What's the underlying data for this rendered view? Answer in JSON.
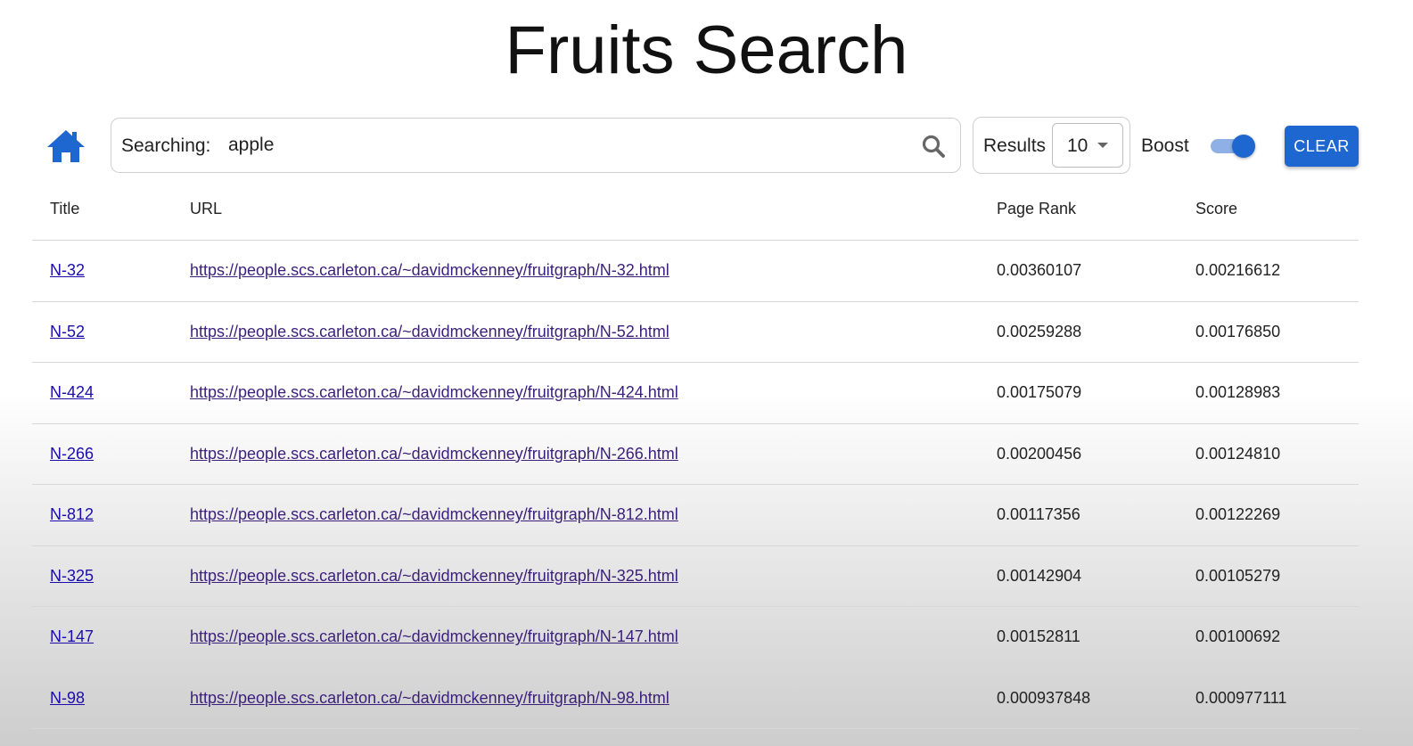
{
  "title": "Fruits Search",
  "search": {
    "label": "Searching:",
    "value": "apple"
  },
  "results_control": {
    "label": "Results",
    "value": "10"
  },
  "boost": {
    "label": "Boost",
    "enabled": true
  },
  "clear_label": "CLEAR",
  "colors": {
    "accent": "#1e66d0",
    "link": "#1a0dab"
  },
  "table": {
    "headers": [
      "Title",
      "URL",
      "Page Rank",
      "Score"
    ],
    "rows": [
      {
        "title": "N-32",
        "url": "https://people.scs.carleton.ca/~davidmckenney/fruitgraph/N-32.html",
        "page_rank": "0.00360107",
        "score": "0.00216612"
      },
      {
        "title": "N-52",
        "url": "https://people.scs.carleton.ca/~davidmckenney/fruitgraph/N-52.html",
        "page_rank": "0.00259288",
        "score": "0.00176850"
      },
      {
        "title": "N-424",
        "url": "https://people.scs.carleton.ca/~davidmckenney/fruitgraph/N-424.html",
        "page_rank": "0.00175079",
        "score": "0.00128983"
      },
      {
        "title": "N-266",
        "url": "https://people.scs.carleton.ca/~davidmckenney/fruitgraph/N-266.html",
        "page_rank": "0.00200456",
        "score": "0.00124810"
      },
      {
        "title": "N-812",
        "url": "https://people.scs.carleton.ca/~davidmckenney/fruitgraph/N-812.html",
        "page_rank": "0.00117356",
        "score": "0.00122269"
      },
      {
        "title": "N-325",
        "url": "https://people.scs.carleton.ca/~davidmckenney/fruitgraph/N-325.html",
        "page_rank": "0.00142904",
        "score": "0.00105279"
      },
      {
        "title": "N-147",
        "url": "https://people.scs.carleton.ca/~davidmckenney/fruitgraph/N-147.html",
        "page_rank": "0.00152811",
        "score": "0.00100692"
      },
      {
        "title": "N-98",
        "url": "https://people.scs.carleton.ca/~davidmckenney/fruitgraph/N-98.html",
        "page_rank": "0.000937848",
        "score": "0.000977111"
      }
    ]
  }
}
